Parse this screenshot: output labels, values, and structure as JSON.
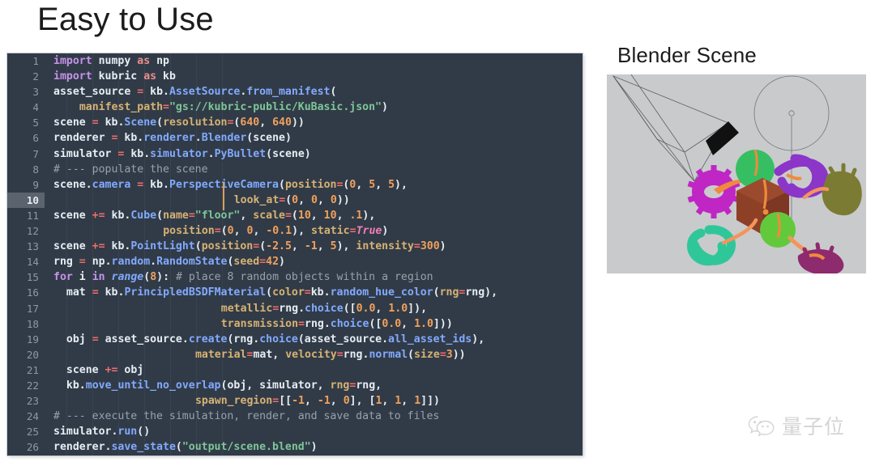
{
  "slide": {
    "title": "Easy to Use"
  },
  "code_panel": {
    "language": "python",
    "active_line": 10,
    "background": "#313b47",
    "gutter_active_background": "#5b636e",
    "cursor_color": "#d9a05b",
    "lines": [
      {
        "n": "1",
        "text": "import numpy as np"
      },
      {
        "n": "2",
        "text": "import kubric as kb"
      },
      {
        "n": "3",
        "text": "asset_source = kb.AssetSource.from_manifest("
      },
      {
        "n": "4",
        "text": "    manifest_path=\"gs://kubric-public/KuBasic.json\")"
      },
      {
        "n": "5",
        "text": "scene = kb.Scene(resolution=(640, 640))"
      },
      {
        "n": "6",
        "text": "renderer = kb.renderer.Blender(scene)"
      },
      {
        "n": "7",
        "text": "simulator = kb.simulator.PyBullet(scene)"
      },
      {
        "n": "8",
        "text": "# --- populate the scene"
      },
      {
        "n": "9",
        "text": "scene.camera = kb.PerspectiveCamera(position=(0, 5, 5),"
      },
      {
        "n": "10",
        "text": "                            look_at=(0, 0, 0))"
      },
      {
        "n": "11",
        "text": "scene += kb.Cube(name=\"floor\", scale=(10, 10, .1),"
      },
      {
        "n": "12",
        "text": "                 position=(0, 0, -0.1), static=True)"
      },
      {
        "n": "13",
        "text": "scene += kb.PointLight(position=(-2.5, -1, 5), intensity=300)"
      },
      {
        "n": "14",
        "text": "rng = np.random.RandomState(seed=42)"
      },
      {
        "n": "15",
        "text": "for i in range(8): # place 8 random objects within a region"
      },
      {
        "n": "16",
        "text": "  mat = kb.PrincipledBSDFMaterial(color=kb.random_hue_color(rng=rng),"
      },
      {
        "n": "17",
        "text": "                          metallic=rng.choice([0.0, 1.0]),"
      },
      {
        "n": "18",
        "text": "                          transmission=rng.choice([0.0, 1.0]))"
      },
      {
        "n": "19",
        "text": "  obj = asset_source.create(rng.choice(asset_source.all_asset_ids),"
      },
      {
        "n": "20",
        "text": "                      material=mat, velocity=rng.normal(size=3))"
      },
      {
        "n": "21",
        "text": "  scene += obj"
      },
      {
        "n": "22",
        "text": "  kb.move_until_no_overlap(obj, simulator, rng=rng,"
      },
      {
        "n": "23",
        "text": "                      spawn_region=[[-1, -1, 0], [1, 1, 1]])"
      },
      {
        "n": "24",
        "text": "# --- execute the simulation, render, and save data to files"
      },
      {
        "n": "25",
        "text": "simulator.run()"
      },
      {
        "n": "26",
        "text": "renderer.save_state(\"output/scene.blend\")"
      }
    ]
  },
  "blender_panel": {
    "heading": "Blender Scene",
    "viewport_background": "#c9cacc",
    "objects": [
      {
        "name": "camera-wireframe",
        "color": "#555a60"
      },
      {
        "name": "light-gizmo",
        "color": "#6a6f76"
      },
      {
        "name": "gear-torus",
        "color": "#c92fd0"
      },
      {
        "name": "sphere-green",
        "color": "#3cc26a"
      },
      {
        "name": "cube-brown",
        "color": "#8c3f27"
      },
      {
        "name": "knot-purple",
        "color": "#8b35c9"
      },
      {
        "name": "knot-teal",
        "color": "#2fc79a"
      },
      {
        "name": "sphere-lime",
        "color": "#63c93c"
      },
      {
        "name": "blob-olive",
        "color": "#7a7a32"
      },
      {
        "name": "blob-magenta",
        "color": "#8e2a6e"
      }
    ]
  },
  "watermark": {
    "text": "量子位",
    "icon": "wechat-icon"
  }
}
